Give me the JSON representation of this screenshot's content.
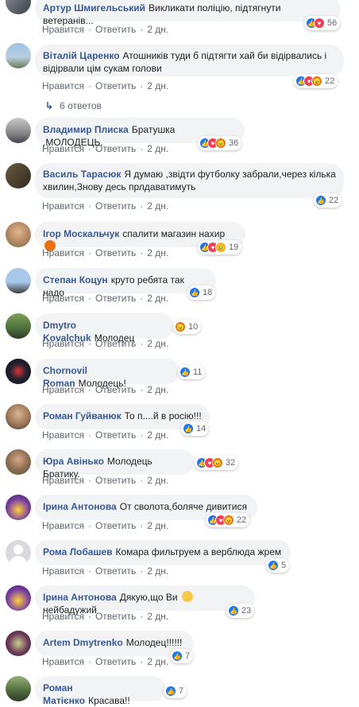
{
  "actions": {
    "like": "Нравится",
    "reply": "Ответить",
    "sep": "·"
  },
  "replies_label": "6 ответов",
  "comments": [
    {
      "author": "Артур Шмигельський",
      "text": "Викликати поліцію, підтягнути ветеранів...",
      "time": "2 дн.",
      "reactions": [
        "like",
        "love"
      ],
      "count": "56"
    },
    {
      "author": "Віталій Царенко",
      "text": "Атошників туди б підтягти хай би відірвались і відірвали цім сукам голови",
      "time": "2 дн.",
      "reactions": [
        "like",
        "love",
        "angry"
      ],
      "count": "22"
    },
    {
      "author": "Владимир Плиска",
      "text": "Братушка ,МОЛОДЕЦЬ.",
      "time": "2 дн.",
      "reactions": [
        "like",
        "love",
        "angry"
      ],
      "count": "36"
    },
    {
      "author": "Василь Тарасюк",
      "text": "Я думаю ,звідти футболку забрали,через кілька хвилин,Знову десь прлдаватимуть",
      "time": "2 дн.",
      "reactions": [
        "like"
      ],
      "count": "22"
    },
    {
      "author": "Ігор Москальчук",
      "text": "спалити магазин нахир",
      "time": "2 дн.",
      "reactions": [
        "like",
        "love",
        "sad"
      ],
      "count": "19"
    },
    {
      "author": "Степан Коцун",
      "text": "круто ребята так надо",
      "time": "2 дн.",
      "reactions": [
        "like"
      ],
      "count": "18"
    },
    {
      "author": "Dmytro Kovalchuk",
      "text": "Молодец",
      "time": "2 дн.",
      "reactions": [
        "angry"
      ],
      "count": "10"
    },
    {
      "author": "Chornovil Roman",
      "text": "Молодець!",
      "time": "2 дн.",
      "reactions": [
        "like"
      ],
      "count": "11"
    },
    {
      "author": "Роман Гуйванюк",
      "text": "То п....й в росію!!!",
      "time": "2 дн.",
      "reactions": [
        "like"
      ],
      "count": "14"
    },
    {
      "author": "Юра Авінько",
      "text": "Молодець Братику.",
      "time": "2 дн.",
      "reactions": [
        "like",
        "love",
        "angry"
      ],
      "count": "32"
    },
    {
      "author": "Ірина Антонова",
      "text": "От сволота,боляче дивитися",
      "time": "2 дн.",
      "reactions": [
        "like",
        "love",
        "angry"
      ],
      "count": "22"
    },
    {
      "author": "Рома Лобашев",
      "text": "Комара фильтруем а верблюда жрем",
      "time": "2 дн.",
      "reactions": [
        "like"
      ],
      "count": "5"
    },
    {
      "author": "Ірина Антонова",
      "text": "Дякую,що Ви",
      "text2": "нейбадужий",
      "time": "2 дн.",
      "reactions": [
        "like"
      ],
      "count": "23"
    },
    {
      "author": "Artem Dmytrenko",
      "text": "Молодец!!!!!!",
      "time": "2 дн.",
      "reactions": [
        "like"
      ],
      "count": "7"
    },
    {
      "author": "Роман Матієнко",
      "text": "Красава!!",
      "time": "",
      "reactions": [
        "like"
      ],
      "count": "7"
    }
  ]
}
